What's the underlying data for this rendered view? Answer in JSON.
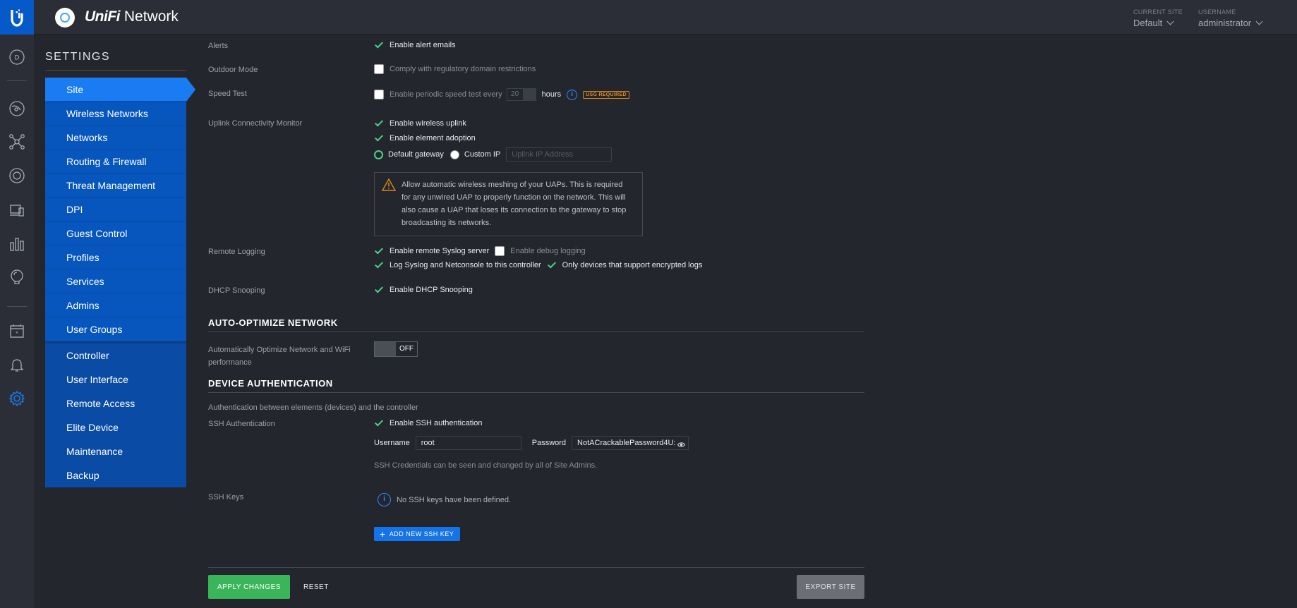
{
  "header": {
    "brand_unifi": "UniFi",
    "brand_network": "Network",
    "current_site_label": "CURRENT SITE",
    "current_site_value": "Default",
    "username_label": "USERNAME",
    "username_value": "administrator"
  },
  "rail": {
    "avatar_letter": "D"
  },
  "sidebar": {
    "title": "SETTINGS",
    "items": [
      {
        "label": "Site"
      },
      {
        "label": "Wireless Networks"
      },
      {
        "label": "Networks"
      },
      {
        "label": "Routing & Firewall"
      },
      {
        "label": "Threat Management"
      },
      {
        "label": "DPI"
      },
      {
        "label": "Guest Control"
      },
      {
        "label": "Profiles"
      },
      {
        "label": "Services"
      },
      {
        "label": "Admins"
      },
      {
        "label": "User Groups"
      },
      {
        "label": "Controller"
      },
      {
        "label": "User Interface"
      },
      {
        "label": "Remote Access"
      },
      {
        "label": "Elite Device"
      },
      {
        "label": "Maintenance"
      },
      {
        "label": "Backup"
      }
    ]
  },
  "form": {
    "alerts": {
      "label": "Alerts",
      "enable_emails": "Enable alert emails"
    },
    "outdoor": {
      "label": "Outdoor Mode",
      "comply": "Comply with regulatory domain restrictions"
    },
    "speedtest": {
      "label": "Speed Test",
      "enable": "Enable periodic speed test every",
      "hours_value": "20",
      "hours_label": "hours",
      "info": "i",
      "badge": "USG REQUIRED"
    },
    "uplink": {
      "label": "Uplink Connectivity Monitor",
      "wireless_uplink": "Enable wireless uplink",
      "element_adoption": "Enable element adoption",
      "default_gateway": "Default gateway",
      "custom_ip": "Custom IP",
      "uplink_ip_placeholder": "Uplink IP Address",
      "warning": "Allow automatic wireless meshing of your UAPs. This is required for any unwired UAP to properly function on the network. This will also cause a UAP that loses its connection to the gateway to stop broadcasting its networks."
    },
    "remote_logging": {
      "label": "Remote Logging",
      "syslog": "Enable remote Syslog server",
      "debug": "Enable debug logging",
      "netconsole": "Log Syslog and Netconsole to this controller",
      "encrypted": "Only devices that support encrypted logs"
    },
    "dhcp": {
      "label": "DHCP Snooping",
      "enable": "Enable DHCP Snooping"
    }
  },
  "auto_optimize": {
    "heading": "AUTO-OPTIMIZE NETWORK",
    "label": "Automatically Optimize Network and WiFi performance",
    "toggle_state": "OFF"
  },
  "device_auth": {
    "heading": "DEVICE AUTHENTICATION",
    "subtitle": "Authentication between elements (devices) and the controller",
    "ssh_label": "SSH Authentication",
    "ssh_enable": "Enable SSH authentication",
    "username_label": "Username",
    "username_value": "root",
    "password_label": "Password",
    "password_value": "NotACrackablePassword4U:",
    "hint": "SSH Credentials can be seen and changed by all of Site Admins.",
    "keys_label": "SSH Keys",
    "no_keys": "No SSH keys have been defined.",
    "info": "i",
    "add_key": "ADD NEW SSH KEY"
  },
  "footer": {
    "apply": "APPLY CHANGES",
    "reset": "RESET",
    "export": "EXPORT SITE"
  },
  "colors": {
    "accent": "#1a7cf3",
    "nav": "#0656be",
    "check": "#4cd28a",
    "apply": "#3ab55a",
    "warning": "#e08a1e"
  }
}
